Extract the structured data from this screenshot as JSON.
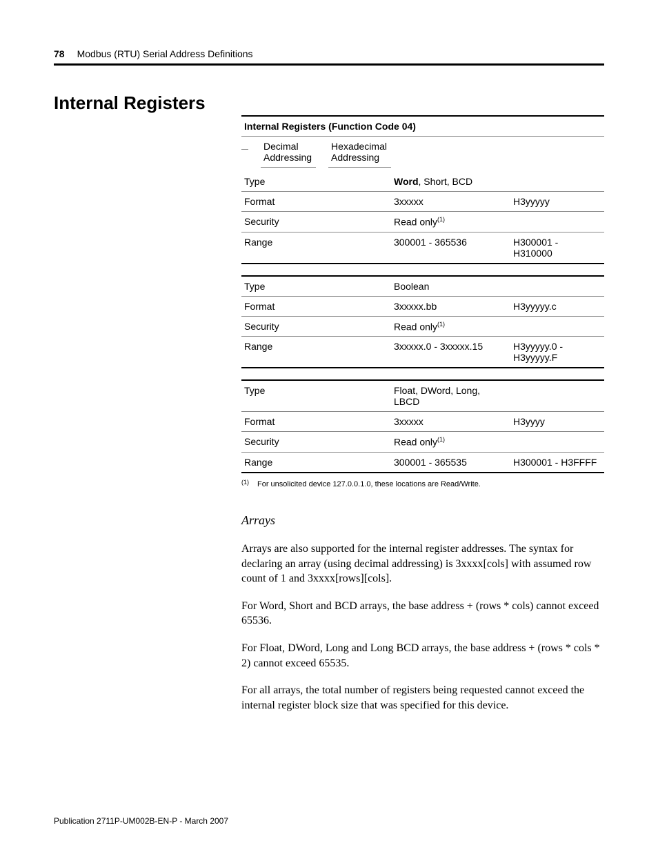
{
  "header": {
    "page_number": "78",
    "chapter": "Modbus (RTU) Serial Address Definitions"
  },
  "section_title": "Internal Registers",
  "table": {
    "title": "Internal Registers (Function Code 04)",
    "col_headers": {
      "c1": "",
      "c2": "Decimal Addressing",
      "c3": "Hexadecimal Addressing"
    },
    "groups": [
      {
        "rows": [
          {
            "c1": "Type",
            "c2_bold": "Word",
            "c2_rest": ", Short, BCD",
            "c3": ""
          },
          {
            "c1": "Format",
            "c2": "3xxxxx",
            "c3": "H3yyyyy"
          },
          {
            "c1": "Security",
            "c2": "Read only",
            "c2_sup": "(1)",
            "c3": ""
          },
          {
            "c1": "Range",
            "c2": "300001 - 365536",
            "c3": "H300001 - H310000"
          }
        ]
      },
      {
        "rows": [
          {
            "c1": "Type",
            "c2": "Boolean",
            "c3": ""
          },
          {
            "c1": "Format",
            "c2": "3xxxxx.bb",
            "c3": "H3yyyyy.c"
          },
          {
            "c1": "Security",
            "c2": "Read only",
            "c2_sup": "(1)",
            "c3": ""
          },
          {
            "c1": "Range",
            "c2": "3xxxxx.0 - 3xxxxx.15",
            "c3": "H3yyyyy.0 - H3yyyyy.F"
          }
        ]
      },
      {
        "rows": [
          {
            "c1": "Type",
            "c2": "Float, DWord, Long, LBCD",
            "c3": ""
          },
          {
            "c1": "Format",
            "c2": "3xxxxx",
            "c3": "H3yyyy"
          },
          {
            "c1": "Security",
            "c2": "Read only",
            "c2_sup": "(1)",
            "c3": ""
          },
          {
            "c1": "Range",
            "c2": "300001 - 365535",
            "c3": "H300001 - H3FFFF"
          }
        ]
      }
    ]
  },
  "footnote": {
    "mark": "(1)",
    "text": "For unsolicited device 127.0.0.1.0, these locations are Read/Write."
  },
  "subhead": "Arrays",
  "paragraphs": [
    "Arrays are also supported for the internal register addresses. The syntax for declaring an array (using decimal addressing) is 3xxxx[cols] with assumed row count of 1 and 3xxxx[rows][cols].",
    "For Word, Short and BCD arrays, the base address + (rows * cols) cannot exceed 65536.",
    "For Float, DWord, Long and Long BCD arrays, the base address + (rows * cols * 2) cannot exceed 65535.",
    "For all arrays, the total number of registers being requested cannot exceed the internal register block size that was specified for this device."
  ],
  "publication": "Publication 2711P-UM002B-EN-P - March 2007"
}
